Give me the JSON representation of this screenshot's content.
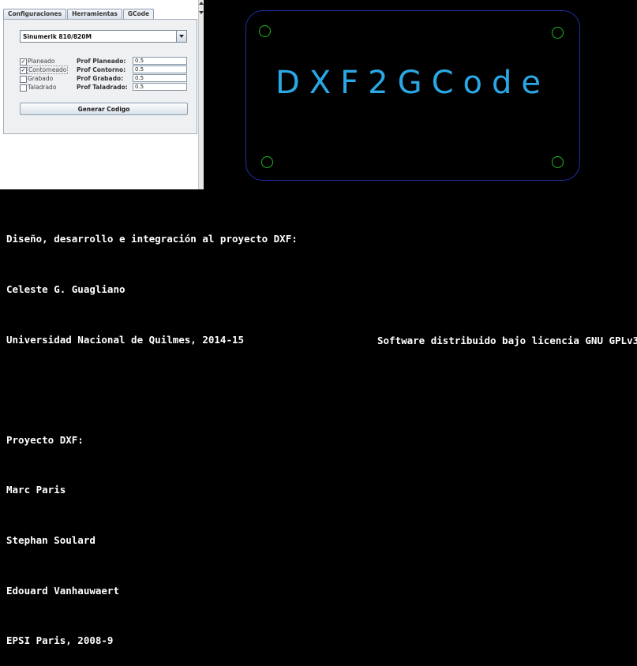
{
  "tabs": [
    "Configuraciones",
    "Herramientas",
    "GCode"
  ],
  "active_tab": "GCode",
  "machine_select": {
    "selected": "Sinumerik 810/820M"
  },
  "operations": [
    {
      "label": "Planeado",
      "checked": true,
      "field_label": "Prof Planeado:",
      "value": "0.5"
    },
    {
      "label": "Contorneado",
      "checked": true,
      "field_label": "Prof Contorno:",
      "value": "0.5"
    },
    {
      "label": "Grabado",
      "checked": false,
      "field_label": "Prof Grabado:",
      "value": "0.5"
    },
    {
      "label": "Taladrado",
      "checked": false,
      "field_label": "Prof Taladrado:",
      "value": "0.5"
    }
  ],
  "generate_button": "Generar Codigo",
  "logo": {
    "text": "DXF2GCode",
    "text_color": "#2aa8e6",
    "border_color": "#1f2ea8",
    "hole_color": "#1fb81f"
  },
  "credits": {
    "lines": [
      "Diseño, desarrollo e integración al proyecto DXF:",
      "Celeste G. Guagliano",
      "Universidad Nacional de Quilmes, 2014-15",
      "",
      "Proyecto DXF:",
      "Marc Paris",
      "Stephan Soulard",
      "Edouard Vanhauwaert",
      "EPSI Paris, 2008-9"
    ],
    "license": "Software distribuido bajo licencia GNU GPLv3"
  }
}
